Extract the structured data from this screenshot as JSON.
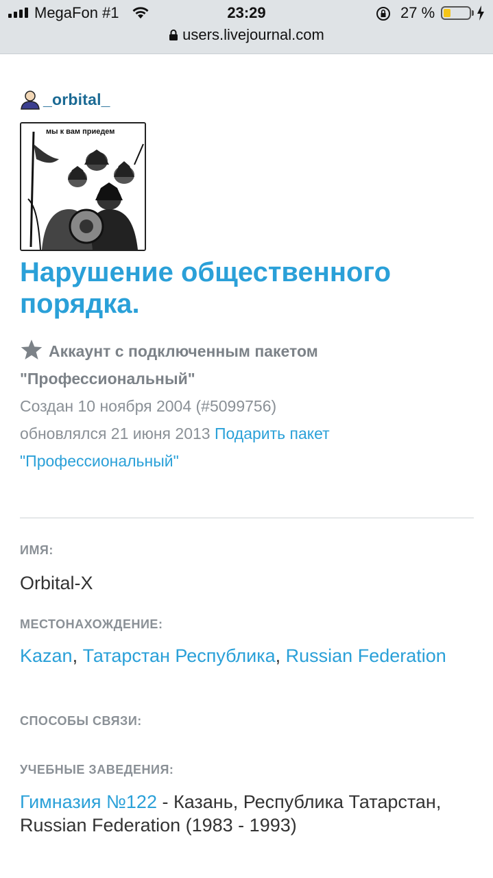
{
  "status_bar": {
    "carrier": "MegaFon #1",
    "time": "23:29",
    "battery_text": "27 %",
    "battery_level": 0.27,
    "battery_color": "#f5c518"
  },
  "url_bar": {
    "url": "users.livejournal.com",
    "icon": "padlock-icon"
  },
  "profile": {
    "username": "_orbital_",
    "user_icon": "user-head-icon",
    "userpic_caption": "мы к вам приедем",
    "journal_title": "Нарушение общественного порядка.",
    "paid_text": "Аккаунт с подключенным пакетом \"Профессиональный\"",
    "created_text": "Создан 10 ноября 2004 (#5099756)",
    "updated_text": "обновлялся 21 июня 2013",
    "gift_link": "Подарить пакет \"Профессиональный\""
  },
  "fields": {
    "name_label": "ИМЯ:",
    "name_value": "Orbital-X",
    "location_label": "МЕСТОНАХОЖДЕНИЕ:",
    "location_city": "Kazan",
    "location_region": "Татарстан Республика",
    "location_country": "Russian Federation",
    "contacts_label": "СПОСОБЫ СВЯЗИ:",
    "schools_label": "УЧЕБНЫЕ ЗАВЕДЕНИЯ:",
    "school_link": "Гимназия №122",
    "school_details": " - Казань, Республика Татарстан, Russian Federation (1983 - 1993)"
  },
  "colors": {
    "accent": "#2aa0d8",
    "username": "#1b6a94",
    "muted": "#8a9096"
  }
}
